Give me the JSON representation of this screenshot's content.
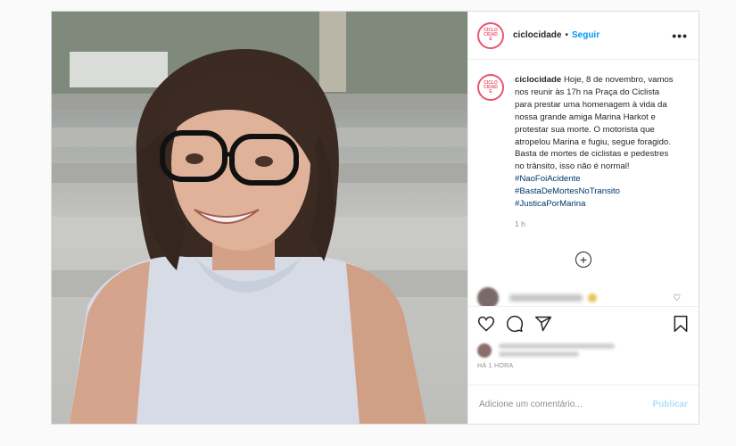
{
  "post": {
    "username": "ciclocidade",
    "avatar_text": "CICLO CIDADE",
    "follow_label": "Seguir",
    "more_label": "•••",
    "caption": {
      "username": "ciclocidade",
      "text": "Hoje, 8 de novembro, vamos nos reunir às 17h na Praça do Ciclista para prestar uma homenagem à vida da nossa grande amiga Marina Harkot e protestar sua morte. O motorista que atropelou Marina e fugiu, segue foragido. Basta de mortes de ciclistas e pedestres no trânsito, isso não é normal!",
      "hashtags": [
        "#NaoFoiAcidente",
        "#BastaDeMortesNoTransito",
        "#JusticaPorMarina"
      ]
    },
    "caption_time": "1 h",
    "posted_time": "HÁ 1 HORA",
    "add_comment_placeholder": "Adicione um comentário...",
    "publish_label": "Publicar",
    "colors": {
      "accent": "#0095f6",
      "publish_disabled": "#b2dffc",
      "hashtag": "#00376b",
      "brand_ring": "#e8566f"
    }
  }
}
